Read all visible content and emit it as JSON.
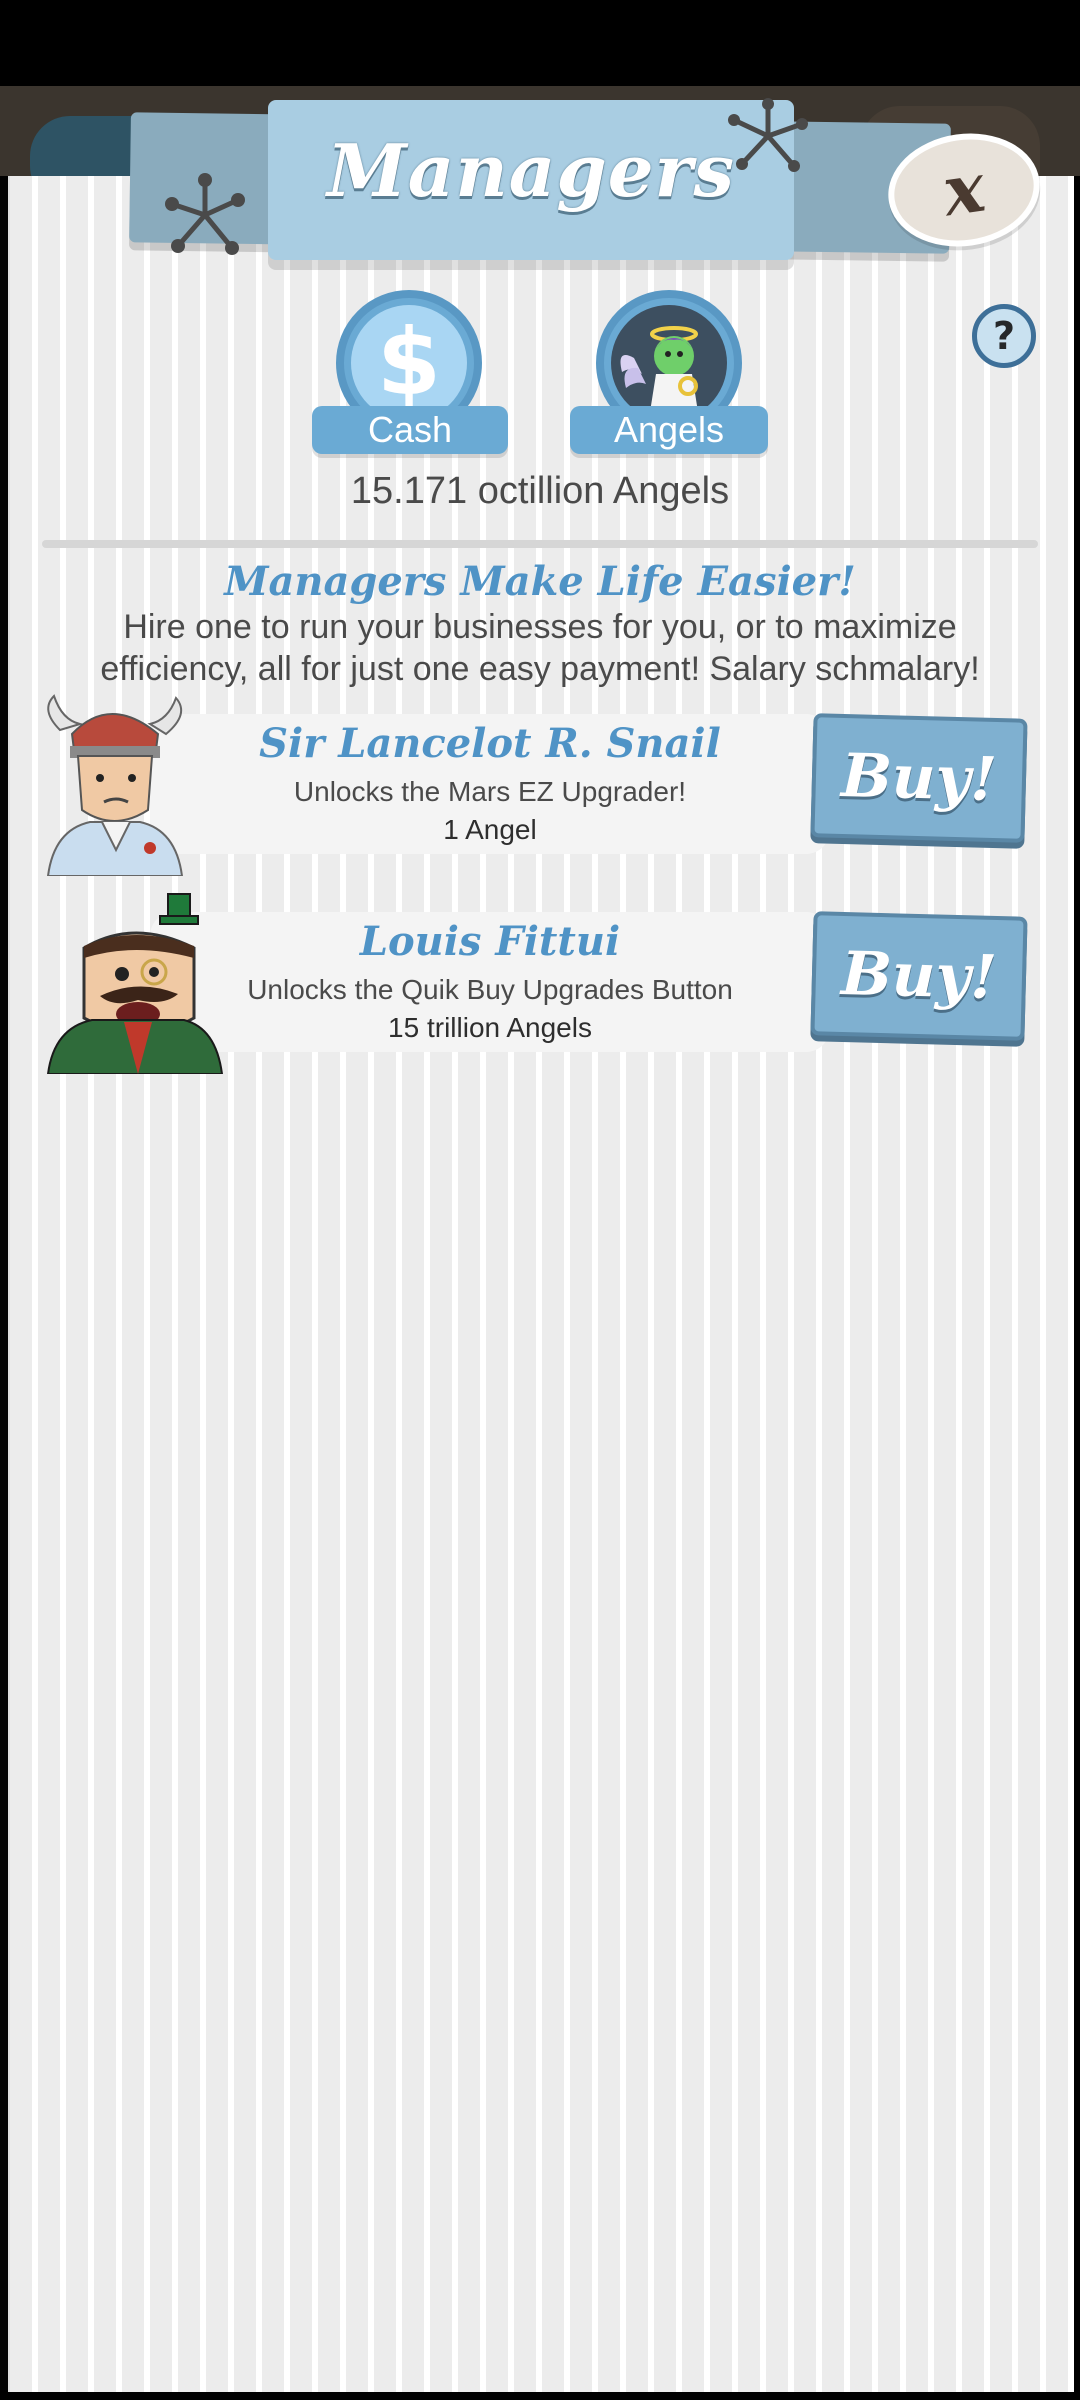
{
  "header": {
    "title": "Managers",
    "close_label": "x"
  },
  "help": {
    "label": "?"
  },
  "currency_tabs": [
    {
      "label": "Cash",
      "icon": "dollar-icon",
      "symbol": "$"
    },
    {
      "label": "Angels",
      "icon": "angel-icon"
    }
  ],
  "balance": "15.171 octillion Angels",
  "promo": {
    "title": "Managers Make Life Easier!",
    "text": "Hire one to run your businesses for you, or to maximize efficiency, all for just one easy payment! Salary schmalary!"
  },
  "managers": [
    {
      "name": "Sir Lancelot R. Snail",
      "description": "Unlocks the Mars EZ Upgrader!",
      "cost": "1 Angel",
      "buy_label": "Buy!"
    },
    {
      "name": "Louis Fittui",
      "description": "Unlocks the Quik Buy Upgrades Button",
      "cost": "15 trillion Angels",
      "buy_label": "Buy!"
    }
  ],
  "colors": {
    "accent_blue": "#4f93c6",
    "button_blue": "#7fb0d0",
    "panel_bg": "#ececec",
    "text_dark": "#4a4a4a"
  }
}
